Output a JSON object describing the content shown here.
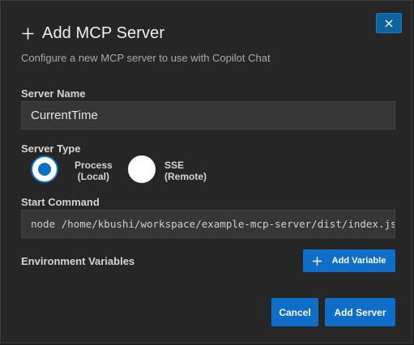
{
  "dialog": {
    "title": "Add MCP Server",
    "subtitle": "Configure a new MCP server to use with Copilot Chat",
    "close_icon": "close-icon",
    "title_icon": "plus-icon"
  },
  "form": {
    "server_name": {
      "label": "Server Name",
      "value": "CurrentTime"
    },
    "server_type": {
      "label": "Server Type",
      "selected": "process",
      "options": [
        {
          "id": "process",
          "line1": "Process",
          "line2": "(Local)"
        },
        {
          "id": "sse",
          "line1": "SSE",
          "line2": "(Remote)"
        }
      ]
    },
    "start_command": {
      "label": "Start Command",
      "value": "node /home/kbushi/workspace/example-mcp-server/dist/index.js"
    },
    "environment_variables": {
      "label": "Environment Variables",
      "add_button_label": "Add Variable",
      "add_button_icon": "plus-icon"
    }
  },
  "actions": {
    "cancel_label": "Cancel",
    "submit_label": "Add Server"
  },
  "colors": {
    "background": "#262626",
    "input_background": "#363636",
    "accent": "#0e6ec8",
    "text": "#d4d4d4",
    "muted_text": "#a9a9a9"
  }
}
